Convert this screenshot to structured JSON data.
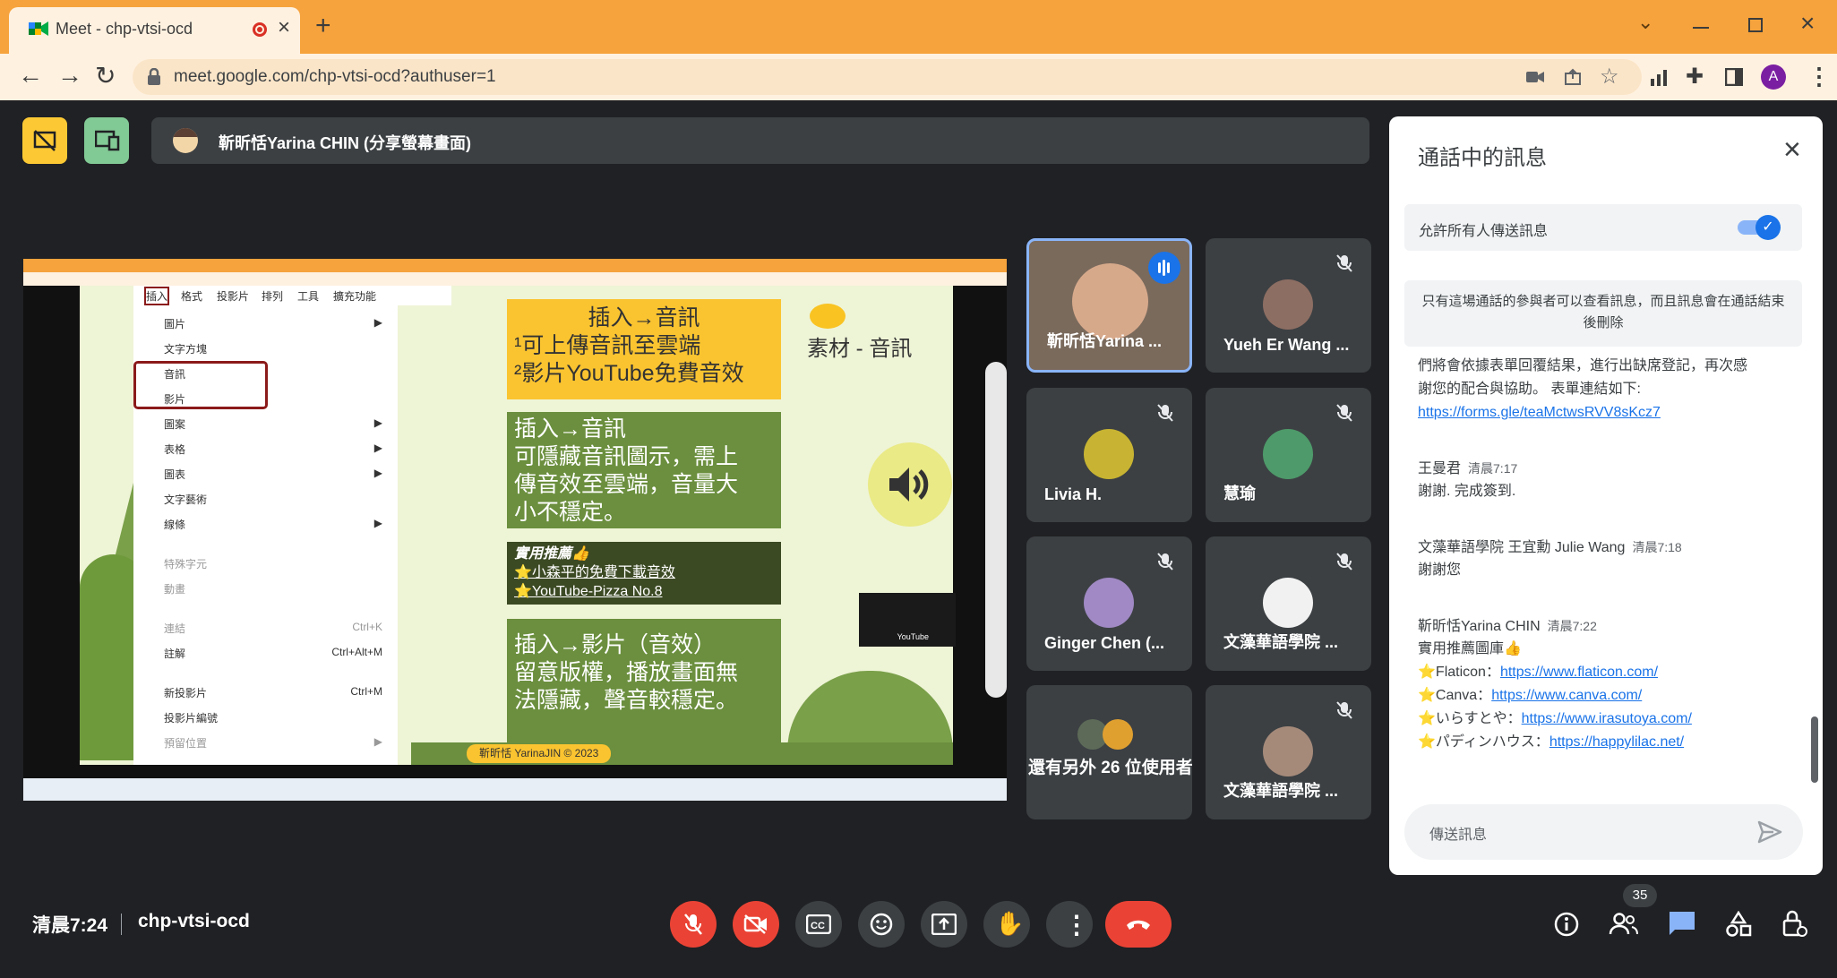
{
  "browser": {
    "tab_title": "Meet - chp-vtsi-ocd",
    "url": "meet.google.com/chp-vtsi-ocd?authuser=1",
    "profile_initial": "A"
  },
  "meet": {
    "presenter_label": "靳昕恬Yarina CHIN (分享螢幕畫面)",
    "meeting_time": "清晨7:24",
    "meeting_code": "chp-vtsi-ocd",
    "people_count": "35"
  },
  "participants": [
    {
      "name": "靳昕恬Yarina ..."
    },
    {
      "name": "Yueh Er Wang ..."
    },
    {
      "name": "Livia H."
    },
    {
      "name": "慧瑜"
    },
    {
      "name": "Ginger Chen (..."
    },
    {
      "name": "文藻華語學院 ..."
    },
    {
      "name": "還有另外 26 位使用者"
    },
    {
      "name": "文藻華語學院 ..."
    }
  ],
  "chat": {
    "title": "通話中的訊息",
    "allow_label": "允許所有人傳送訊息",
    "notice": "只有這場通話的參與者可以查看訊息，而且訊息會在通話結束後刪除",
    "msg1_line1": "們將會依據表單回覆結果，進行出缺席登記，再次感",
    "msg1_line2": "謝您的配合與協助。 表單連結如下:",
    "msg1_link": "https://forms.gle/teaMctwsRVV8sKcz7",
    "m2_sender": "王曼君",
    "m2_time": "清晨7:17",
    "m2_text": "謝謝. 完成簽到.",
    "m3_sender": "文藻華語學院 王宜勳 Julie Wang",
    "m3_time": "清晨7:18",
    "m3_text": "謝謝您",
    "m4_sender": "靳昕恬Yarina CHIN",
    "m4_time": "清晨7:22",
    "m4_text": "實用推薦圖庫👍",
    "r1_label": "⭐Flaticon：",
    "r1_link": "https://www.flaticon.com/",
    "r2_label": "⭐Canva：",
    "r2_link": "https://www.canva.com/",
    "r3_label": "⭐いらすとや：",
    "r3_link": "https://www.irasutoya.com/",
    "r4_label": "⭐パディンハウス：",
    "r4_link": "https://happylilac.net/",
    "input_placeholder": "傳送訊息"
  },
  "slide": {
    "menu_bar": [
      "插入",
      "格式",
      "投影片",
      "排列",
      "工具",
      "擴充功能"
    ],
    "menu_items": [
      {
        "label": "圖片",
        "shortcut": "▶"
      },
      {
        "label": "文字方塊",
        "shortcut": ""
      },
      {
        "label": "音訊",
        "shortcut": ""
      },
      {
        "label": "影片",
        "shortcut": ""
      },
      {
        "label": "圖案",
        "shortcut": "▶"
      },
      {
        "label": "表格",
        "shortcut": "▶"
      },
      {
        "label": "圖表",
        "shortcut": "▶"
      },
      {
        "label": "文字藝術",
        "shortcut": ""
      },
      {
        "label": "線條",
        "shortcut": "▶"
      },
      {
        "label": "特殊字元",
        "shortcut": ""
      },
      {
        "label": "動畫",
        "shortcut": ""
      },
      {
        "label": "連結",
        "shortcut": "Ctrl+K"
      },
      {
        "label": "註解",
        "shortcut": "Ctrl+Alt+M"
      },
      {
        "label": "新投影片",
        "shortcut": "Ctrl+M"
      },
      {
        "label": "投影片編號",
        "shortcut": ""
      },
      {
        "label": "預留位置",
        "shortcut": "▶"
      }
    ],
    "box1_title": "插入→音訊",
    "box1_l1": "¹可上傳音訊至雲端",
    "box1_l2": "²影片YouTube免費音效",
    "side_title": "素材 - 音訊",
    "box2_l1": "插入→音訊",
    "box2_l2": "可隱藏音訊圖示，需上",
    "box2_l3": "傳音效至雲端，音量大",
    "box2_l4": "小不穩定。",
    "box3_title": "實用推薦👍",
    "box3_l1": "⭐小森平的免費下載音效",
    "box3_l2": "⭐YouTube-Pizza No.8",
    "box4_l1": "插入→影片（音效）",
    "box4_l2": "留意版權，播放畫面無",
    "box4_l3": "法隱藏，聲音較穩定。",
    "footer": "靳昕恬 YarinaJIN © 2023",
    "yt_label": "YouTube"
  }
}
